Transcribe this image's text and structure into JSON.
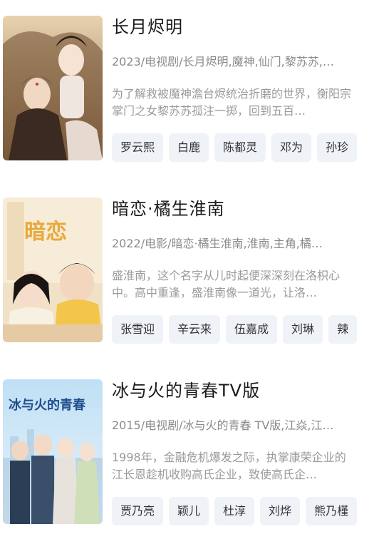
{
  "items": [
    {
      "title": "长月烬明",
      "meta": "2023/电视剧/长月烬明,魔神,仙门,黎苏苏,…",
      "desc": "为了解救被魔神澹台烬统治折磨的世界，衡阳宗掌门之女黎苏苏孤注一掷，回到五百…",
      "cast": [
        "罗云熙",
        "白鹿",
        "陈都灵",
        "邓为",
        "孙珍"
      ],
      "poster_text": "",
      "poster_colors": {
        "bg": "#c9a883",
        "accent": "#6b4a2e"
      }
    },
    {
      "title": "暗恋·橘生淮南",
      "meta": "2022/电影/暗恋·橘生淮南,淮南,主角,橘…",
      "desc": "盛淮南，这个名字从儿时起便深深刻在洛枳心中。高中重逢，盛淮南像一道光，让洛…",
      "cast": [
        "张雪迎",
        "辛云来",
        "伍嘉成",
        "刘琳",
        "辣"
      ],
      "poster_text": "暗恋",
      "poster_colors": {
        "bg": "#f3e3c8",
        "accent": "#e7a93b"
      }
    },
    {
      "title": "冰与火的青春TV版",
      "meta": "2015/电视剧/冰与火的青春 TV版,江焱,江…",
      "desc": "1998年，金融危机爆发之际，执掌康荣企业的江长恩趁机收购高氏企业，致使高氏企…",
      "cast": [
        "贾乃亮",
        "颖儿",
        "杜淳",
        "刘烨",
        "熊乃槿"
      ],
      "poster_text": "冰与火的青春",
      "poster_colors": {
        "bg": "#cfe3f2",
        "accent": "#1f4e8c"
      }
    }
  ]
}
